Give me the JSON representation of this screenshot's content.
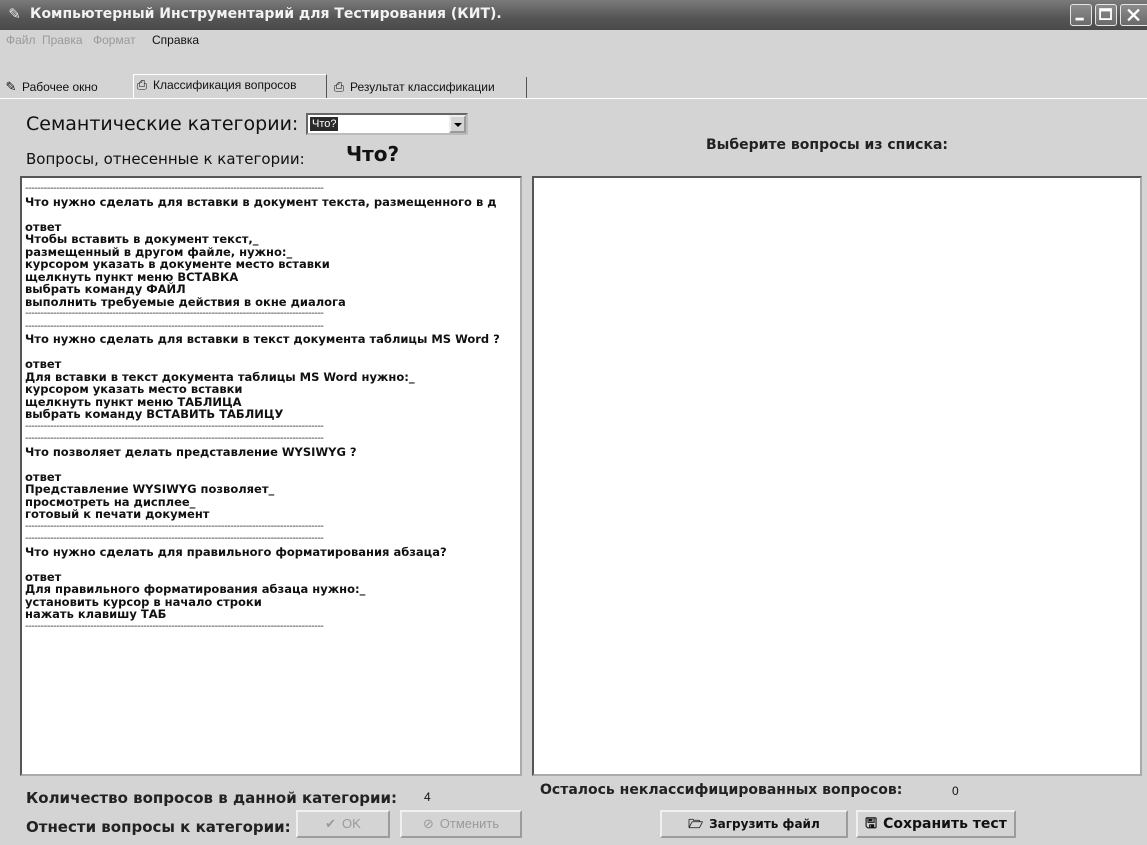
{
  "window": {
    "title": "Компьютерный Инструментарий для Тестирования (КИТ)."
  },
  "menu": [
    "Файл",
    "Правка",
    "Формат",
    "Справка"
  ],
  "tabs": [
    {
      "label": "Рабочее окно",
      "icon": "pencil-icon"
    },
    {
      "label": "Классификация вопросов",
      "icon": "printer-icon"
    },
    {
      "label": "Результат классификации",
      "icon": "printer-icon"
    }
  ],
  "semantic": {
    "label": "Семантические категории:",
    "selected": "Что?"
  },
  "questions": {
    "label": "Вопросы, отнесенные к категории:",
    "category": "Что?"
  },
  "picker": {
    "label": "Выберите вопросы из списка:"
  },
  "question_lines": [
    "------------------------------------------------------------------------------------------------",
    "Что нужно сделать для вставки  в документ текста, размещенного в д",
    "",
    "ответ",
    "Чтобы  вставить в документ текст,_",
    "размещенный в другом файле, нужно:_",
    "курсором указать в документе место вставки",
    "щелкнуть пункт меню ВСТАВКА",
    "выбрать команду ФАЙЛ",
    "выполнить требуемые действия в окне диалога",
    "------------------------------------------------------------------------------------------------",
    "------------------------------------------------------------------------------------------------",
    "Что нужно сделать для вставки в текст документа таблицы MS Word ?",
    "",
    "ответ",
    "Для вставки в текст документа таблицы MS Word  нужно:_",
    "курсором указать место вставки",
    "щелкнуть пункт меню ТАБЛИЦА",
    "выбрать команду ВСТАВИТЬ ТАБЛИЦУ",
    "------------------------------------------------------------------------------------------------",
    "------------------------------------------------------------------------------------------------",
    "Что позволяет делать  представление WYSIWYG ?",
    "",
    "ответ",
    "Представление WYSIWYG позволяет_",
    "просмотреть на дисплее_",
    "готовый к печати документ",
    "------------------------------------------------------------------------------------------------",
    "------------------------------------------------------------------------------------------------",
    "Что нужно сделать для правильного форматирования абзаца?",
    "",
    "ответ",
    "Для правильного форматирования абзаца нужно:_",
    "установить курсор в начало строки",
    "нажать клавишу ТАБ",
    "------------------------------------------------------------------------------------------------"
  ],
  "footer": {
    "count_label": "Количество вопросов в данной категории:",
    "count_value": "4",
    "remaining_label": "Осталось неклассифицированных вопросов:",
    "remaining_value": "0",
    "assign_label": "Отнести вопросы к категории:",
    "ok_label": "OK",
    "cancel_label": "Отменить",
    "load_label": "Загрузить файл",
    "save_label": "Сохранить тест"
  }
}
